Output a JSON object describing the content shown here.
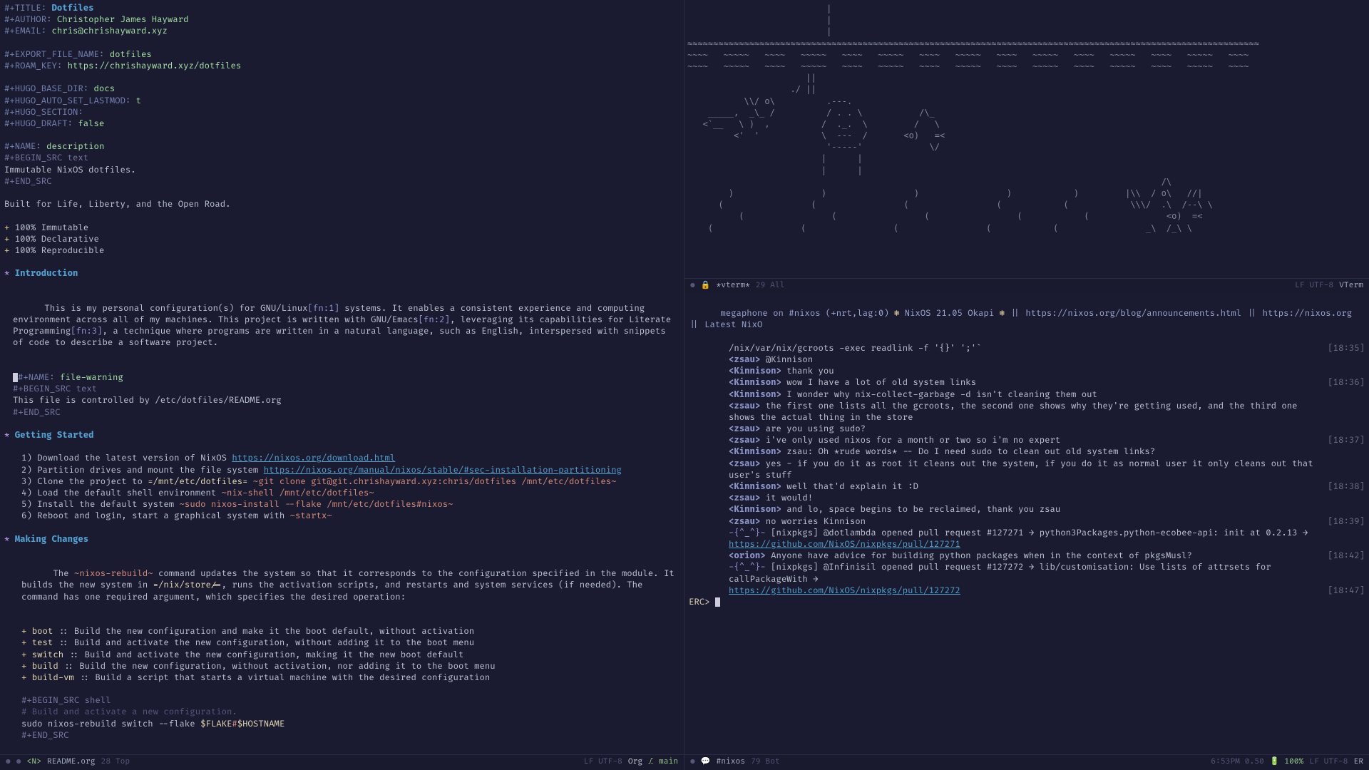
{
  "left": {
    "header": {
      "k_title": "#+TITLE:",
      "title": "Dotfiles",
      "k_author": "#+AUTHOR:",
      "author": "Christopher James Hayward",
      "k_email": "#+EMAIL:",
      "email": "chris@chrishayward.xyz",
      "k_export": "#+EXPORT_FILE_NAME:",
      "export": "dotfiles",
      "k_roam": "#+ROAM_KEY:",
      "roam": "https://chrishayward.xyz/dotfiles",
      "k_hbase": "#+HUGO_BASE_DIR:",
      "hbase": "docs",
      "k_hlast": "#+HUGO_AUTO_SET_LASTMOD:",
      "hlast": "t",
      "k_hsect": "#+HUGO_SECTION:",
      "hsect": "",
      "k_hdraft": "#+HUGO_DRAFT:",
      "hdraft": "false",
      "k_name_desc": "#+NAME:",
      "name_desc": "description",
      "k_begin_text": "#+BEGIN_SRC",
      "begin_lang_text": "text",
      "desc_text": "Immutable NixOS dotfiles.",
      "k_end_src": "#+END_SRC",
      "tagline": "Built for Life, Liberty, and the Open Road.",
      "bullet1": "100% Immutable",
      "bullet2": "100% Declarative",
      "bullet3": "100% Reproducible"
    },
    "intro": {
      "heading": "Introduction",
      "para1a": "This is my personal configuration(s) for GNU/Linux",
      "fn1": "[fn:1]",
      "para1b": " systems. It enables a consistent experience and computing environment across all of my machines. This project is written with GNU/Emacs",
      "fn2": "[fn:2]",
      "para1c": ", leveraging its capabilities for Literate Programming",
      "fn3": "[fn:3]",
      "para1d": ", a technique where programs are written in a natural language, such as English, interspersed with snippets of code to describe a software project.",
      "name_fw": "file-warning",
      "fw_text": "This file is controlled by /etc/dotfiles/README.org"
    },
    "getting_started": {
      "heading": "Getting Started",
      "s1a": "1) Download the latest version of NixOS ",
      "s1_url": "https://nixos.org/download.html",
      "s2a": "2) Partition drives and mount the file system ",
      "s2_url": "https://nixos.org/manual/nixos/stable/#sec-installation-partitioning",
      "s3a": "3) Clone the project to ",
      "s3_code1": "=/mnt/etc/dotfiles=",
      "s3_code2": " ~git clone git@git.chrishayward.xyz:chris/dotfiles /mnt/etc/dotfiles~",
      "s4a": "4) Load the default shell environment ",
      "s4_code": "~nix-shell /mnt/etc/dotfiles~",
      "s5a": "5) Install the default system ",
      "s5_code": "~sudo nixos-install --flake /mnt/etc/dotfiles#nixos~",
      "s6a": "6) Reboot and login, start a graphical system with ",
      "s6_code": "~startx~"
    },
    "making_changes": {
      "heading": "Making Changes",
      "p1a": "The ",
      "p1_cmd": "~nixos-rebuild~",
      "p1b": " command updates the system so that it corresponds to the configuration specified in the module. It builds the new system in ",
      "p1_path": "=/nix/store/=",
      "p1c": ", runs the activation scripts, and restarts and system services (if needed). The command has one required argument, which specifies the desired operation:",
      "ops": [
        {
          "name": "boot",
          "desc": "Build the new configuration and make it the boot default, without activation"
        },
        {
          "name": "test",
          "desc": "Build and activate the new configuration, without adding it to the boot menu"
        },
        {
          "name": "switch",
          "desc": "Build and activate the new configuration, making it the new boot default"
        },
        {
          "name": "build",
          "desc": "Build the new configuration, without activation, nor adding it to the boot menu"
        },
        {
          "name": "build-vm",
          "desc": "Build a script that starts a virtual machine with the desired configuration"
        }
      ],
      "src_shell_begin": "#+BEGIN_SRC shell",
      "src_shell_comment": "# Build and activate a new configuration.",
      "src_shell_cmd_a": "sudo nixos-rebuild switch --flake ",
      "src_shell_flake": "$FLAKE",
      "src_shell_hash": "#",
      "src_shell_host": "$HOSTNAME",
      "src_end": "#+END_SRC"
    },
    "modeline": {
      "disk": "●",
      "save": "●",
      "evil": "<N>",
      "name": "README.org",
      "position": "28 Top",
      "enc": "LF UTF-8",
      "mode": "Org",
      "vcs_icon": "⎇",
      "vcs": "main"
    }
  },
  "vterm": {
    "modeline": {
      "dot": "●",
      "ro": "🔒",
      "name": "*vterm*",
      "pos": "29 All",
      "enc": "LF UTF-8",
      "mode": "VTerm"
    }
  },
  "erc": {
    "topic_a": "megaphone on #nixos (+nrt,lag:0) ",
    "topic_b": " NixOS 21.05 Okapi ",
    "topic_c": " || https://nixos.org/blog/announcements.html || https://nixos.org || Latest NixO",
    "messages": [
      {
        "ts": "",
        "nick": "",
        "text": "/nix/var/nix/gcroots -exec readlink -f '{}' ';'`",
        "rts": "[18:35]"
      },
      {
        "ts": "",
        "nick": "<zsau>",
        "text": "@Kinnison"
      },
      {
        "ts": "",
        "nick": "<Kinnison>",
        "text": "thank you"
      },
      {
        "ts": "",
        "nick": "<Kinnison>",
        "text": "wow I have a lot of old system links",
        "rts": "[18:36]"
      },
      {
        "ts": "",
        "nick": "<Kinnison>",
        "text": "I wonder why nix-collect-garbage -d isn't cleaning them out"
      },
      {
        "ts": "",
        "nick": "<zsau>",
        "text": "the first one lists all the gcroots, the second one shows why they're getting used, and the third one shows the actual thing in the store"
      },
      {
        "ts": "",
        "nick": "<zsau>",
        "text": "are you using sudo?"
      },
      {
        "ts": "",
        "nick": "<zsau>",
        "text": "i've only used nixos for a month or two so i'm no expert",
        "rts": "[18:37]"
      },
      {
        "ts": "",
        "nick": "<Kinnison>",
        "text": "zsau: Oh *rude words* -- Do I need sudo to clean out old system links?"
      },
      {
        "ts": "",
        "nick": "<zsau>",
        "text": "yes - if you do it as root it cleans out the system, if you do it as normal user it only cleans out that user's stuff"
      },
      {
        "ts": "",
        "nick": "<Kinnison>",
        "text": "well that'd explain it :D",
        "rts": "[18:38]"
      },
      {
        "ts": "",
        "nick": "<zsau>",
        "text": "it would!"
      },
      {
        "ts": "",
        "nick": "<Kinnison>",
        "text": "and lo, space begins to be reclaimed, thank you zsau"
      },
      {
        "ts": "",
        "nick": "<zsau>",
        "text": "no worries Kinnison",
        "rts": "[18:39]"
      },
      {
        "ts": "",
        "nick": "-{^_^}-",
        "text": "[nixpkgs] @dotlambda opened pull request #127271 → python3Packages.python-ecobee-api: init at 0.2.13 →",
        "pr": true
      },
      {
        "ts": "",
        "nick": "",
        "url": "https://github.com/NixOS/nixpkgs/pull/127271"
      },
      {
        "ts": "",
        "nick": "<orion>",
        "text": "Anyone have advice for building python packages when in the context of pkgsMusl?",
        "rts": "[18:42]"
      },
      {
        "ts": "",
        "nick": "-{^_^}-",
        "text": "[nixpkgs] @Infinisil opened pull request #127272 → lib/customisation: Use lists of attrsets for callPackageWith →",
        "pr": true
      },
      {
        "ts": "",
        "nick": "",
        "url": "https://github.com/NixOS/nixpkgs/pull/127272",
        "rts": "[18:47]"
      }
    ],
    "prompt": "ERC>",
    "modeline": {
      "dot": "●",
      "chat": "💬",
      "name": "#nixos",
      "pos": "79 Bot",
      "clock": "6:53PM 0.50",
      "bat": "🔋 100%",
      "enc": "LF UTF-8",
      "mode": "ER"
    }
  },
  "ascii": "                           |\n                           |\n                           |\n≈≈≈≈≈≈≈≈≈≈≈≈≈≈≈≈≈≈≈≈≈≈≈≈≈≈≈≈≈≈≈≈≈≈≈≈≈≈≈≈≈≈≈≈≈≈≈≈≈≈≈≈≈≈≈≈≈≈≈≈≈≈≈≈≈≈≈≈≈≈≈≈≈≈≈≈≈≈≈≈≈≈≈≈≈≈≈≈≈≈≈≈≈≈≈≈≈≈≈≈≈≈≈≈≈≈≈≈≈≈≈\n~~~~   ~~~~~   ~~~~   ~~~~~   ~~~~   ~~~~~   ~~~~   ~~~~~   ~~~~   ~~~~~   ~~~~   ~~~~~   ~~~~   ~~~~~   ~~~~\n~~~~   ~~~~~   ~~~~   ~~~~~   ~~~~   ~~~~~   ~~~~   ~~~~~   ~~~~   ~~~~~   ~~~~   ~~~~~   ~~~~   ~~~~~   ~~~~\n                       ||\n                    ./ ||\n           \\\\/ o\\          .---.\n    _____,  _\\_ /          / . . \\           /\\_\n   <`__   \\ )  ,          /  ._.  \\         /   \\\n         <'  '            \\  ---  /       <o)   =<\n                           '-----'             \\/\n                          |      |\n                          |      |\n                                                                                            /\\\n        )                 )                 )                 )            )         |\\\\  / o\\   //|\n      (                 (                 (                 (            (            \\\\\\/  .\\  /--\\ \\\n          (                 (                 (                 (            (               <o)  =<\n    (                 (                 (                 (            (                 _\\  /_\\ \\"
}
